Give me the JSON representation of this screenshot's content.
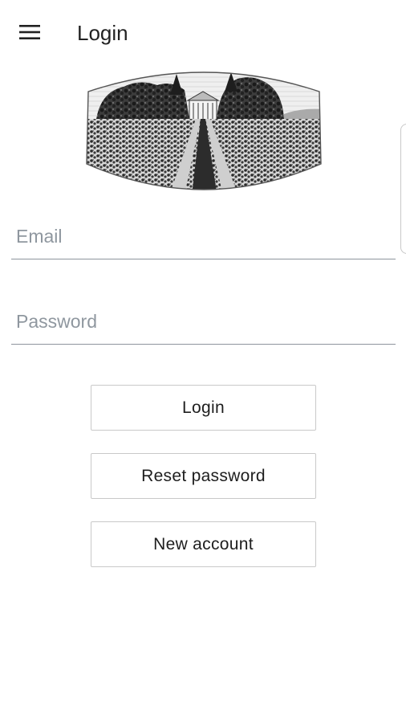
{
  "appbar": {
    "menu_icon": "hamburger-menu-icon",
    "title": "Login"
  },
  "logo": {
    "description_icon": "plantation-engraving-logo"
  },
  "form": {
    "email_placeholder": "Email",
    "email_value": "",
    "password_placeholder": "Password",
    "password_value": ""
  },
  "buttons": {
    "login_label": "Login",
    "reset_label": "Reset password",
    "new_account_label": "New account"
  },
  "colors": {
    "underline": "#8e959d",
    "placeholder": "#8f979f",
    "button_border": "#c9c9c9",
    "text": "#222222"
  }
}
